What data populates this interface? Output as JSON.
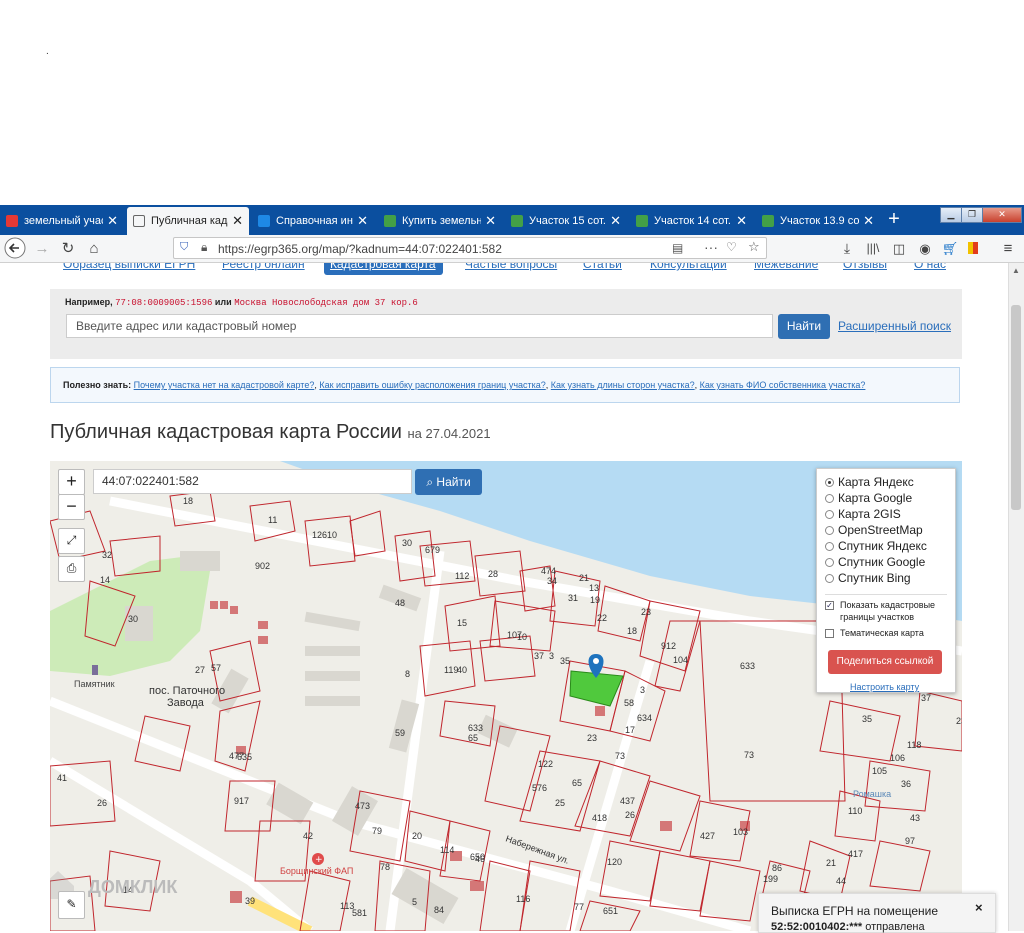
{
  "browser": {
    "tabs": [
      {
        "label": "земельный участ",
        "icon": "yandex-icon"
      },
      {
        "label": "Публичная кадас",
        "icon": "document-icon"
      },
      {
        "label": "Справочная инф",
        "icon": "site-icon"
      },
      {
        "label": "Купить земельн",
        "icon": "domclick-icon"
      },
      {
        "label": "Участок 15 сот. (",
        "icon": "domclick-icon"
      },
      {
        "label": "Участок 14 сот. (",
        "icon": "domclick-icon"
      },
      {
        "label": "Участок 13.9 сот.",
        "icon": "domclick-icon"
      }
    ],
    "url": "https://egrp365.org/map/?kadnum=44:07:022401:582"
  },
  "site_nav": {
    "items": [
      "Образец выписки ЕГРН",
      "Реестр онлайн",
      "Кадастровая карта",
      "Частые вопросы",
      "Статьи",
      "Консультации",
      "Межевание",
      "Отзывы",
      "О нас"
    ]
  },
  "search": {
    "example_prefix": "Например,",
    "example_1": "77:08:0009005:1596",
    "example_or": "или",
    "example_2": "Москва Новослободская дом 37 кор.6",
    "placeholder": "Введите адрес или кадастровый номер",
    "button": "Найти",
    "advanced_link": "Расширенный поиск"
  },
  "tips": {
    "label": "Полезно знать:",
    "links": [
      "Почему участка нет на кадастровой карте?",
      "Как исправить ошибку расположения границ участка?",
      "Как узнать длины сторон участка?",
      "Как узнать ФИО собственника участка?"
    ]
  },
  "page": {
    "title": "Публичная кадастровая карта России",
    "date": "на 27.04.2021"
  },
  "map": {
    "zoom_in": "+",
    "zoom_out": "−",
    "kadnum": "44:07:022401:582",
    "find_button": "Найти",
    "layers": [
      "Карта Яндекс",
      "Карта Google",
      "Карта 2GIS",
      "OpenStreetMap",
      "Спутник Яндекс",
      "Спутник Google",
      "Спутник Bing"
    ],
    "selected_layer": "Карта Яндекс",
    "show_borders_1": "Показать кадастровые",
    "show_borders_2": "границы участков",
    "show_borders_checked": true,
    "thematic": "Тематическая карта",
    "thematic_checked": false,
    "share_button": "Поделиться ссылкой",
    "setup_link": "Настроить карту",
    "place_labels": [
      "Памятник",
      "пос. Паточного",
      "Завода",
      "Набережная ул.",
      "Ромашка",
      "Борщинский ФАП",
      "ДОМКЛИК"
    ],
    "parcel_numbers": [
      "18",
      "11",
      "12610",
      "30",
      "679",
      "112",
      "28",
      "474",
      "34",
      "21",
      "13",
      "31",
      "19",
      "22",
      "23",
      "32",
      "902",
      "14",
      "48",
      "15",
      "107",
      "10",
      "18",
      "912",
      "104",
      "30",
      "27",
      "57",
      "8",
      "119",
      "40",
      "37",
      "3",
      "35",
      "3",
      "58",
      "634",
      "633",
      "633",
      "65",
      "59",
      "23",
      "17",
      "477",
      "635",
      "73",
      "73",
      "122",
      "576",
      "65",
      "25",
      "41",
      "26",
      "917",
      "473",
      "79",
      "20",
      "114",
      "650",
      "418",
      "437",
      "26",
      "42",
      "78",
      "46",
      "120",
      "427",
      "103",
      "110",
      "417",
      "97",
      "39",
      "5",
      "84",
      "14",
      "113",
      "581",
      "116",
      "77",
      "651",
      "118",
      "106",
      "105",
      "36",
      "35",
      "37",
      "23",
      "86",
      "199",
      "21",
      "44",
      "43",
      "40",
      "27",
      "70"
    ]
  },
  "notification": {
    "title": "Выписка ЕГРН на помещение",
    "text_bold": "52:52:0010402:***",
    "text": " отправлена",
    "close": "×"
  },
  "page_dot": "."
}
